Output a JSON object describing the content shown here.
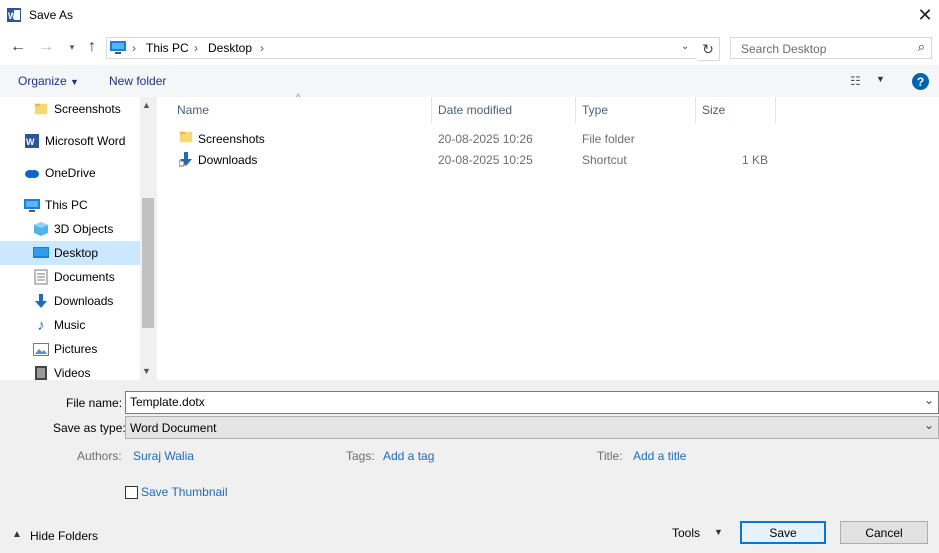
{
  "window": {
    "title": "Save As"
  },
  "nav": {
    "path": [
      "This PC",
      "Desktop"
    ],
    "search_placeholder": "Search Desktop"
  },
  "toolbar": {
    "organize_label": "Organize",
    "new_folder_label": "New folder"
  },
  "sidebar": {
    "items": [
      {
        "label": "Screenshots",
        "icon": "folder-icon"
      },
      {
        "label": "Microsoft Word",
        "icon": "word-icon"
      },
      {
        "label": "OneDrive",
        "icon": "onedrive-icon"
      },
      {
        "label": "This PC",
        "icon": "pc-icon"
      },
      {
        "label": "3D Objects",
        "icon": "cube-icon"
      },
      {
        "label": "Desktop",
        "icon": "desktop-icon",
        "selected": true
      },
      {
        "label": "Documents",
        "icon": "document-icon"
      },
      {
        "label": "Downloads",
        "icon": "download-icon"
      },
      {
        "label": "Music",
        "icon": "music-icon"
      },
      {
        "label": "Pictures",
        "icon": "picture-icon"
      },
      {
        "label": "Videos",
        "icon": "video-icon"
      }
    ]
  },
  "files": {
    "columns": [
      "Name",
      "Date modified",
      "Type",
      "Size"
    ],
    "rows": [
      {
        "name": "Screenshots",
        "date": "20-08-2025 10:26",
        "type": "File folder",
        "size": ""
      },
      {
        "name": "Downloads",
        "date": "20-08-2025 10:25",
        "type": "Shortcut",
        "size": "1 KB"
      }
    ]
  },
  "form": {
    "file_name_label": "File name:",
    "file_name_value": "Template.dotx",
    "save_type_label": "Save as type:",
    "save_type_value": "Word Document",
    "authors_label": "Authors:",
    "authors_value": "Suraj Walia",
    "tags_label": "Tags:",
    "tags_value": "Add a tag",
    "title_label": "Title:",
    "title_value": "Add a title",
    "thumbnail_label": "Save Thumbnail",
    "thumbnail_checked": false
  },
  "footer": {
    "hide_folders_label": "Hide Folders",
    "tools_label": "Tools",
    "save_label": "Save",
    "cancel_label": "Cancel"
  },
  "colors": {
    "accent": "#0078d7",
    "link": "#1e6bb8",
    "selected_bg": "#cce8ff"
  }
}
